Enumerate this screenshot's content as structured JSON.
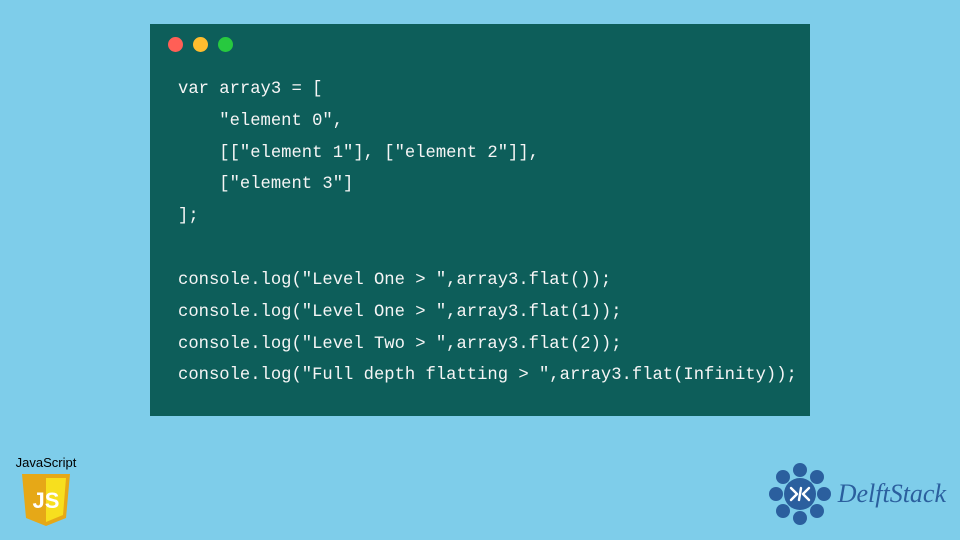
{
  "code": {
    "lines": [
      "var array3 = [",
      "    \"element 0\",",
      "    [[\"element 1\"], [\"element 2\"]],",
      "    [\"element 3\"]",
      "];",
      "",
      "console.log(\"Level One > \",array3.flat());",
      "console.log(\"Level One > \",array3.flat(1));",
      "console.log(\"Level Two > \",array3.flat(2));",
      "console.log(\"Full depth flatting > \",array3.flat(Infinity));"
    ]
  },
  "js_badge": {
    "label": "JavaScript",
    "shield_text": "JS"
  },
  "brand": {
    "name": "DelftStack"
  },
  "colors": {
    "bg": "#7ecdea",
    "window": "#0d5e5a",
    "js_yellow": "#f7df1e",
    "brand_blue": "#2b5f9e"
  }
}
